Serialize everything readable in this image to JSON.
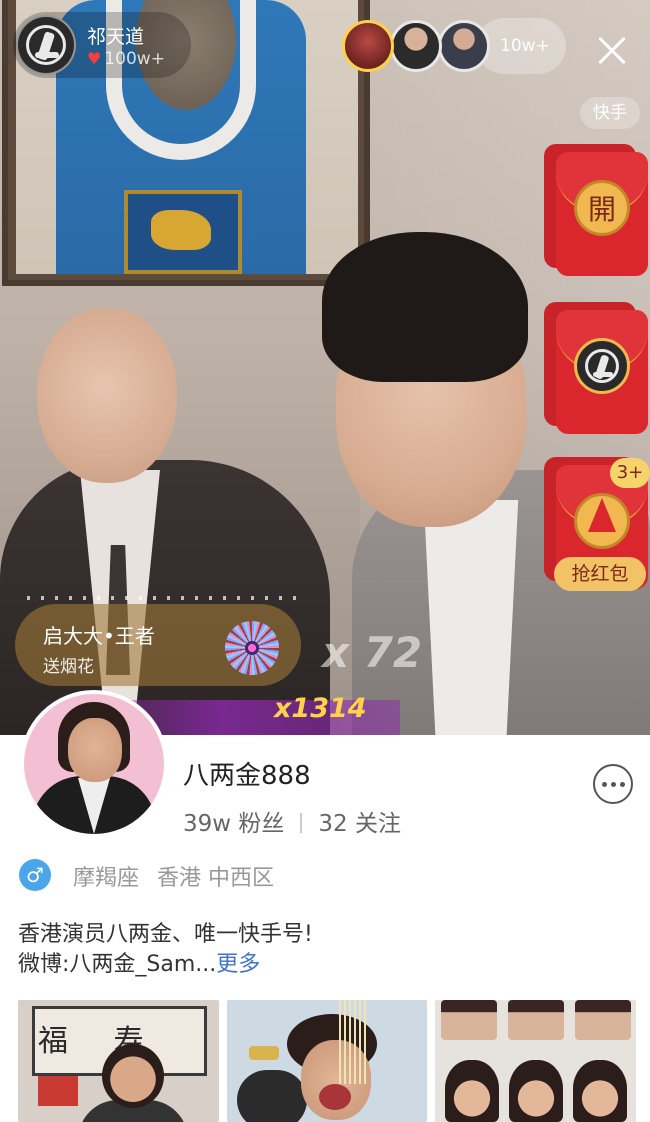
{
  "live": {
    "host": {
      "name": "祁天道",
      "likes": "100w+"
    },
    "viewer_count": "10w+",
    "platform": "快手",
    "red_packets": {
      "open_char": "開",
      "extra_badge": "3+",
      "grab_label": "抢红包"
    },
    "gift": {
      "user": "启大大•王者",
      "action": "送烟花",
      "combo": "x 72",
      "combo_total": "x1314"
    }
  },
  "profile": {
    "username": "八两金888",
    "followers": "39w 粉丝",
    "following": "32 关注",
    "gender": "♂",
    "zodiac": "摩羯座",
    "location": "香港 中西区",
    "bio_line1": "香港演员八两金、唯一快手号!",
    "bio_line2_prefix": "微博:八两金_Sam...",
    "bio_more": "更多",
    "thumb1_text": "福 寿"
  },
  "colors": {
    "accent_link": "#3f74c9",
    "red_packet": "#d9272d",
    "gold": "#f0b84e",
    "gender_male": "#49a6e9"
  }
}
